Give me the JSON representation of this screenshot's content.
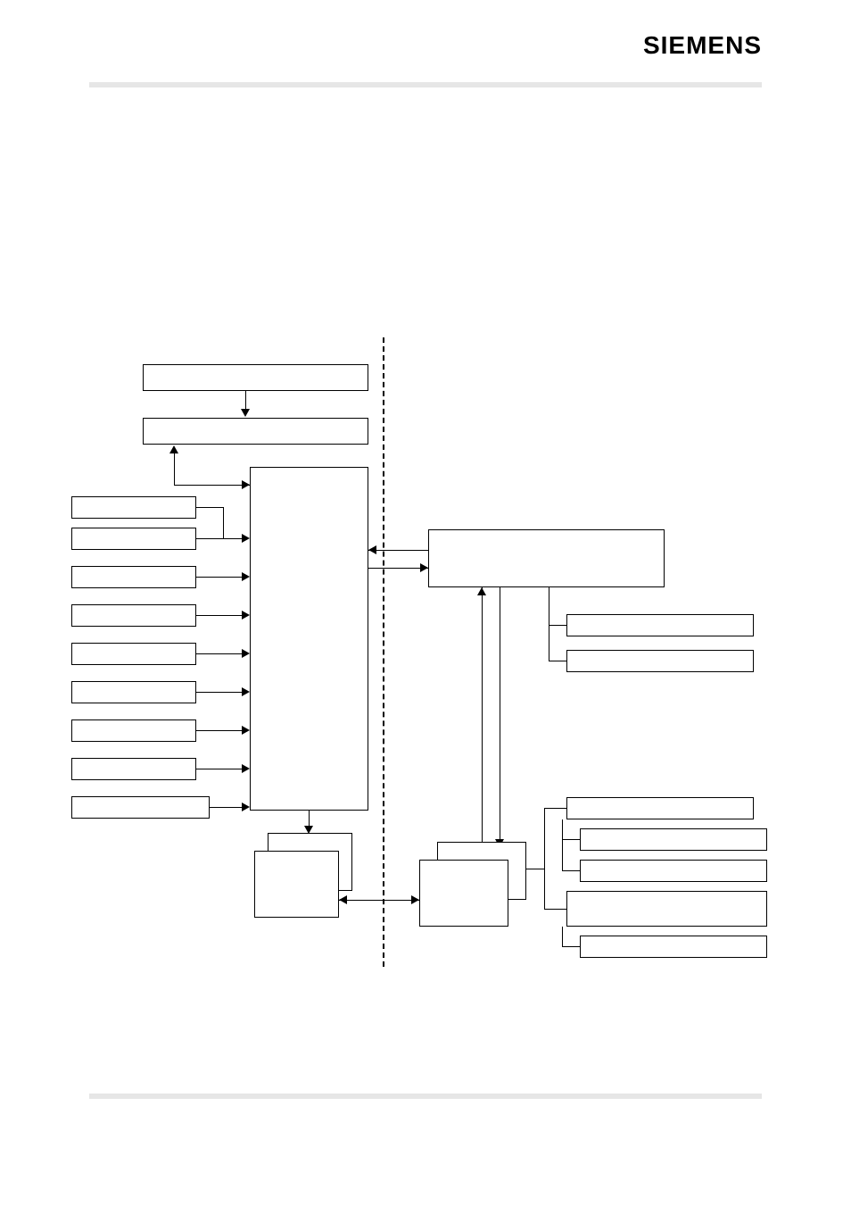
{
  "header": {
    "brand": "SIEMENS"
  },
  "diagram": {
    "boxes": {
      "top_wide": "",
      "second_wide": "",
      "input_1": "",
      "input_2": "",
      "input_3": "",
      "input_4": "",
      "input_5": "",
      "input_6": "",
      "input_7": "",
      "input_8": "",
      "input_9": "",
      "central_tall": "",
      "right_large": "",
      "right_small_1": "",
      "right_small_2": "",
      "bottom_left_stack_back": "",
      "bottom_left_stack_front": "",
      "bottom_mid_stack_back": "",
      "bottom_mid_stack_front": "",
      "far_right_1": "",
      "far_right_2": "",
      "far_right_3": "",
      "far_right_4": "",
      "far_right_5": ""
    }
  }
}
